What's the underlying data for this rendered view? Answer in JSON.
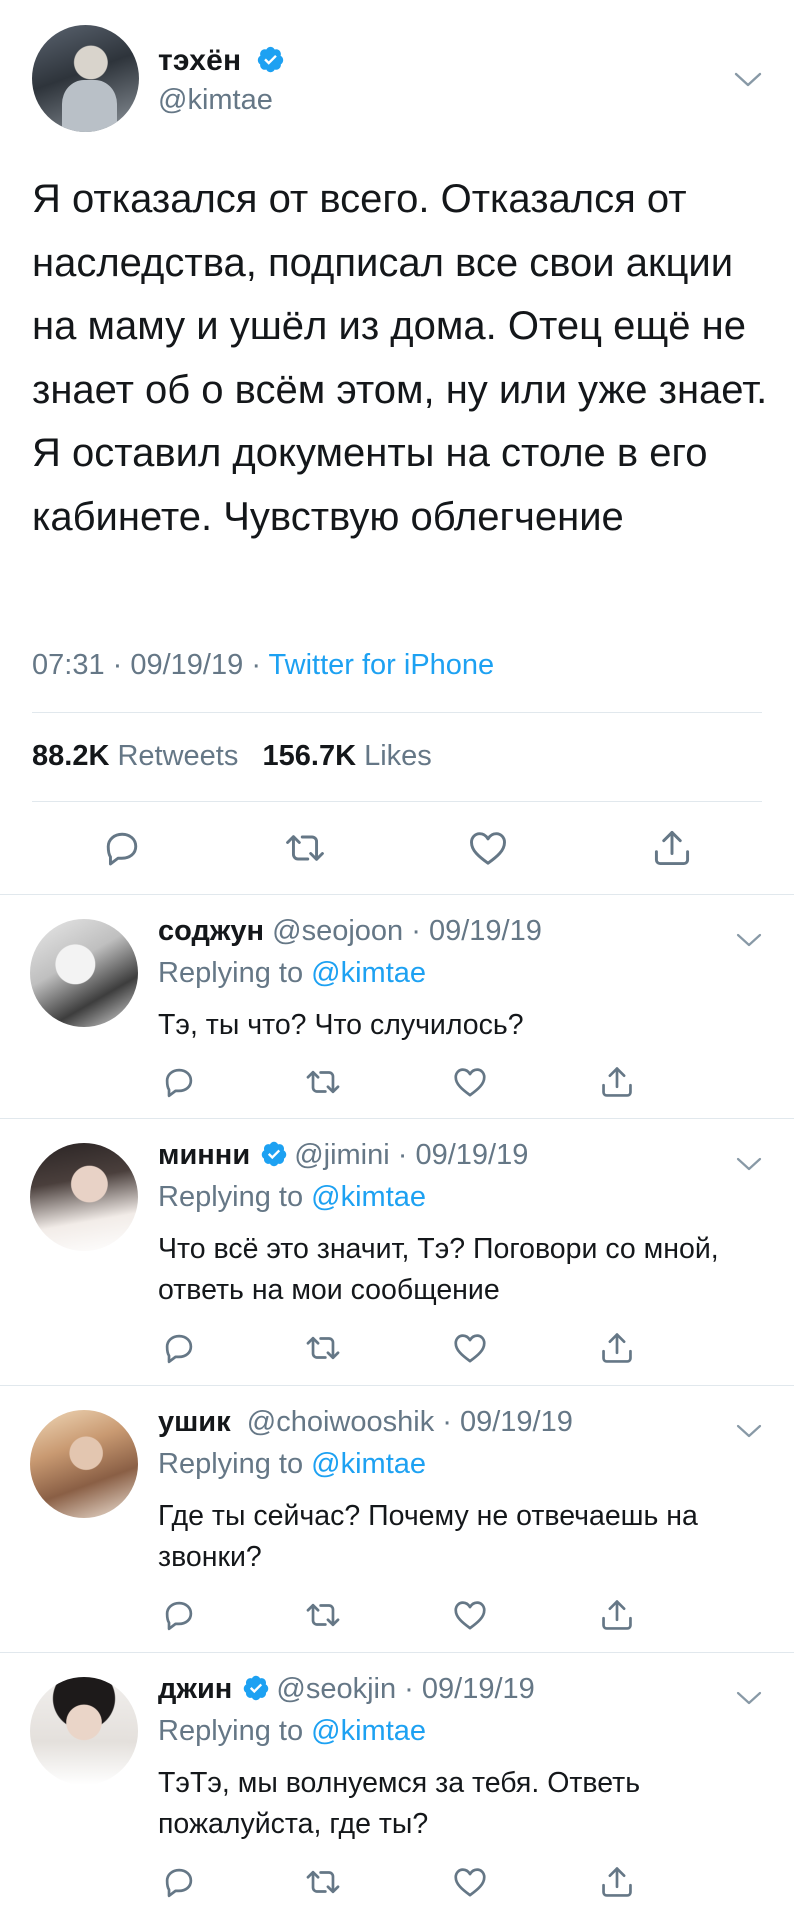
{
  "main_tweet": {
    "author_name": "тэхён",
    "author_handle": "@kimtae",
    "verified": true,
    "text": "Я отказался от всего. Отказался от наследства, подписал все свои акции на маму и ушёл из дома. Отец ещё не знает об о всём этом, ну или уже знает. Я оставил документы на столе в его кабинете. Чувствую облегчение",
    "time": "07:31",
    "date": "09/19/19",
    "separator": "·",
    "source": "Twitter for iPhone",
    "retweets_count": "88.2K",
    "retweets_label": "Retweets",
    "likes_count": "156.7K",
    "likes_label": "Likes"
  },
  "icons": {
    "reply": "reply-icon",
    "retweet": "retweet-icon",
    "like": "heart-icon",
    "share": "share-icon",
    "menu": "chevron-down-icon"
  },
  "colors": {
    "accent": "#1da1f2",
    "secondary_text": "#657786",
    "text": "#14171a",
    "divider": "#e1e8ed"
  },
  "replies": [
    {
      "name": "соджун",
      "handle": "@seojoon",
      "separator": "·",
      "date": "09/19/19",
      "verified": false,
      "replying_label": "Replying to",
      "replying_to": "@kimtae",
      "text": "Тэ, ты что? Что случилось?"
    },
    {
      "name": "минни",
      "handle": "@jimini",
      "separator": "·",
      "date": "09/19/19",
      "verified": true,
      "replying_label": "Replying to",
      "replying_to": "@kimtae",
      "text": "Что всё это значит, Тэ? Поговори со мной, ответь на мои сообщение"
    },
    {
      "name": "ушик",
      "handle": "@choiwooshik",
      "separator": "·",
      "date": "09/19/19",
      "verified": false,
      "replying_label": "Replying to",
      "replying_to": "@kimtae",
      "text": "Где ты сейчас? Почему не отвечаешь на звонки?"
    },
    {
      "name": "джин",
      "handle": "@seokjin",
      "separator": "·",
      "date": "09/19/19",
      "verified": true,
      "replying_label": "Replying to",
      "replying_to": "@kimtae",
      "text": "ТэТэ, мы волнуемся за тебя. Ответь пожалуйста, где ты?"
    }
  ]
}
